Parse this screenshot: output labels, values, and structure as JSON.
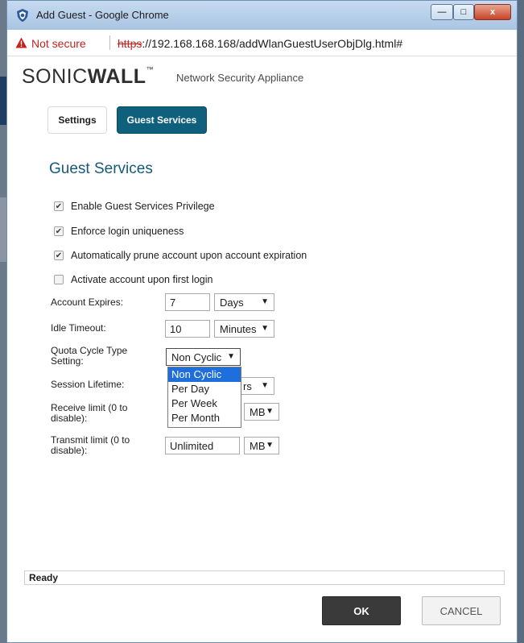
{
  "window": {
    "title": "Add Guest - Google Chrome",
    "minimize_glyph": "—",
    "maximize_glyph": "□",
    "close_glyph": "x"
  },
  "address_bar": {
    "security_label": "Not secure",
    "url_scheme": "https",
    "url_rest": "://192.168.168.168/addWlanGuestUserObjDlg.html#"
  },
  "header": {
    "logo_light": "SONIC",
    "logo_bold": "WALL",
    "logo_tm": "™",
    "product": "Network Security Appliance"
  },
  "tabs": [
    {
      "label": "Settings",
      "active": false
    },
    {
      "label": "Guest Services",
      "active": true
    }
  ],
  "section_title": "Guest Services",
  "checkboxes": [
    {
      "label": "Enable Guest Services Privilege",
      "checked": true
    },
    {
      "label": "Enforce login uniqueness",
      "checked": true
    },
    {
      "label": "Automatically prune account upon account expiration",
      "checked": true
    },
    {
      "label": "Activate account upon first login",
      "checked": false
    }
  ],
  "fields": {
    "account_expires": {
      "label": "Account Expires:",
      "value": "7",
      "unit": "Days"
    },
    "idle_timeout": {
      "label": "Idle Timeout:",
      "value": "10",
      "unit": "Minutes"
    },
    "quota_cycle": {
      "label_line1": "Quota Cycle Type",
      "label_line2": "Setting:",
      "selected": "Non Cyclic"
    },
    "session_lifetime": {
      "label": "Session Lifetime:",
      "unit_partial": "rs"
    },
    "receive_limit": {
      "label_line1": "Receive limit (0 to",
      "label_line2": "disable):",
      "unit": "MB"
    },
    "transmit_limit": {
      "label_line1": "Transmit limit (0 to",
      "label_line2": "disable):",
      "value": "Unlimited",
      "unit": "MB"
    }
  },
  "quota_dropdown": {
    "options": [
      "Non Cyclic",
      "Per Day",
      "Per Week",
      "Per Month"
    ],
    "selected_index": 0
  },
  "status_text": "Ready",
  "buttons": {
    "ok": "OK",
    "cancel": "CANCEL"
  },
  "colors": {
    "accent": "#0f607d",
    "section_title": "#155a7a",
    "not_secure": "#c5221f",
    "dropdown_highlight": "#1e6fdc",
    "ok_button": "#3a3a3a"
  },
  "icons": {
    "title": "sonicwall-shield-icon",
    "security": "warning-triangle-icon",
    "dropdown": "caret-down-icon",
    "checkbox": "checkmark-icon"
  }
}
